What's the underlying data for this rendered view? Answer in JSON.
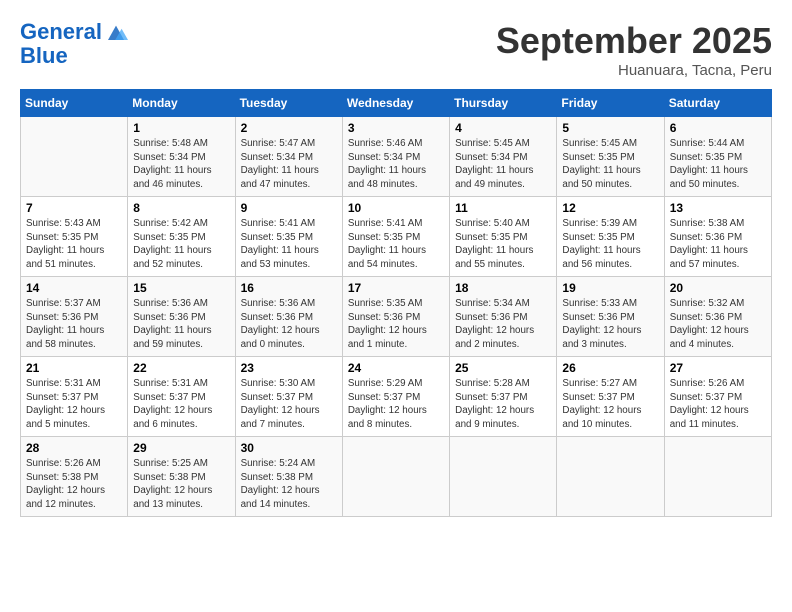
{
  "header": {
    "logo_line1": "General",
    "logo_line2": "Blue",
    "month_title": "September 2025",
    "location": "Huanuara, Tacna, Peru"
  },
  "days_of_week": [
    "Sunday",
    "Monday",
    "Tuesday",
    "Wednesday",
    "Thursday",
    "Friday",
    "Saturday"
  ],
  "weeks": [
    [
      {
        "day": "",
        "sunrise": "",
        "sunset": "",
        "daylight": ""
      },
      {
        "day": "1",
        "sunrise": "Sunrise: 5:48 AM",
        "sunset": "Sunset: 5:34 PM",
        "daylight": "Daylight: 11 hours and 46 minutes."
      },
      {
        "day": "2",
        "sunrise": "Sunrise: 5:47 AM",
        "sunset": "Sunset: 5:34 PM",
        "daylight": "Daylight: 11 hours and 47 minutes."
      },
      {
        "day": "3",
        "sunrise": "Sunrise: 5:46 AM",
        "sunset": "Sunset: 5:34 PM",
        "daylight": "Daylight: 11 hours and 48 minutes."
      },
      {
        "day": "4",
        "sunrise": "Sunrise: 5:45 AM",
        "sunset": "Sunset: 5:34 PM",
        "daylight": "Daylight: 11 hours and 49 minutes."
      },
      {
        "day": "5",
        "sunrise": "Sunrise: 5:45 AM",
        "sunset": "Sunset: 5:35 PM",
        "daylight": "Daylight: 11 hours and 50 minutes."
      },
      {
        "day": "6",
        "sunrise": "Sunrise: 5:44 AM",
        "sunset": "Sunset: 5:35 PM",
        "daylight": "Daylight: 11 hours and 50 minutes."
      }
    ],
    [
      {
        "day": "7",
        "sunrise": "Sunrise: 5:43 AM",
        "sunset": "Sunset: 5:35 PM",
        "daylight": "Daylight: 11 hours and 51 minutes."
      },
      {
        "day": "8",
        "sunrise": "Sunrise: 5:42 AM",
        "sunset": "Sunset: 5:35 PM",
        "daylight": "Daylight: 11 hours and 52 minutes."
      },
      {
        "day": "9",
        "sunrise": "Sunrise: 5:41 AM",
        "sunset": "Sunset: 5:35 PM",
        "daylight": "Daylight: 11 hours and 53 minutes."
      },
      {
        "day": "10",
        "sunrise": "Sunrise: 5:41 AM",
        "sunset": "Sunset: 5:35 PM",
        "daylight": "Daylight: 11 hours and 54 minutes."
      },
      {
        "day": "11",
        "sunrise": "Sunrise: 5:40 AM",
        "sunset": "Sunset: 5:35 PM",
        "daylight": "Daylight: 11 hours and 55 minutes."
      },
      {
        "day": "12",
        "sunrise": "Sunrise: 5:39 AM",
        "sunset": "Sunset: 5:35 PM",
        "daylight": "Daylight: 11 hours and 56 minutes."
      },
      {
        "day": "13",
        "sunrise": "Sunrise: 5:38 AM",
        "sunset": "Sunset: 5:36 PM",
        "daylight": "Daylight: 11 hours and 57 minutes."
      }
    ],
    [
      {
        "day": "14",
        "sunrise": "Sunrise: 5:37 AM",
        "sunset": "Sunset: 5:36 PM",
        "daylight": "Daylight: 11 hours and 58 minutes."
      },
      {
        "day": "15",
        "sunrise": "Sunrise: 5:36 AM",
        "sunset": "Sunset: 5:36 PM",
        "daylight": "Daylight: 11 hours and 59 minutes."
      },
      {
        "day": "16",
        "sunrise": "Sunrise: 5:36 AM",
        "sunset": "Sunset: 5:36 PM",
        "daylight": "Daylight: 12 hours and 0 minutes."
      },
      {
        "day": "17",
        "sunrise": "Sunrise: 5:35 AM",
        "sunset": "Sunset: 5:36 PM",
        "daylight": "Daylight: 12 hours and 1 minute."
      },
      {
        "day": "18",
        "sunrise": "Sunrise: 5:34 AM",
        "sunset": "Sunset: 5:36 PM",
        "daylight": "Daylight: 12 hours and 2 minutes."
      },
      {
        "day": "19",
        "sunrise": "Sunrise: 5:33 AM",
        "sunset": "Sunset: 5:36 PM",
        "daylight": "Daylight: 12 hours and 3 minutes."
      },
      {
        "day": "20",
        "sunrise": "Sunrise: 5:32 AM",
        "sunset": "Sunset: 5:36 PM",
        "daylight": "Daylight: 12 hours and 4 minutes."
      }
    ],
    [
      {
        "day": "21",
        "sunrise": "Sunrise: 5:31 AM",
        "sunset": "Sunset: 5:37 PM",
        "daylight": "Daylight: 12 hours and 5 minutes."
      },
      {
        "day": "22",
        "sunrise": "Sunrise: 5:31 AM",
        "sunset": "Sunset: 5:37 PM",
        "daylight": "Daylight: 12 hours and 6 minutes."
      },
      {
        "day": "23",
        "sunrise": "Sunrise: 5:30 AM",
        "sunset": "Sunset: 5:37 PM",
        "daylight": "Daylight: 12 hours and 7 minutes."
      },
      {
        "day": "24",
        "sunrise": "Sunrise: 5:29 AM",
        "sunset": "Sunset: 5:37 PM",
        "daylight": "Daylight: 12 hours and 8 minutes."
      },
      {
        "day": "25",
        "sunrise": "Sunrise: 5:28 AM",
        "sunset": "Sunset: 5:37 PM",
        "daylight": "Daylight: 12 hours and 9 minutes."
      },
      {
        "day": "26",
        "sunrise": "Sunrise: 5:27 AM",
        "sunset": "Sunset: 5:37 PM",
        "daylight": "Daylight: 12 hours and 10 minutes."
      },
      {
        "day": "27",
        "sunrise": "Sunrise: 5:26 AM",
        "sunset": "Sunset: 5:37 PM",
        "daylight": "Daylight: 12 hours and 11 minutes."
      }
    ],
    [
      {
        "day": "28",
        "sunrise": "Sunrise: 5:26 AM",
        "sunset": "Sunset: 5:38 PM",
        "daylight": "Daylight: 12 hours and 12 minutes."
      },
      {
        "day": "29",
        "sunrise": "Sunrise: 5:25 AM",
        "sunset": "Sunset: 5:38 PM",
        "daylight": "Daylight: 12 hours and 13 minutes."
      },
      {
        "day": "30",
        "sunrise": "Sunrise: 5:24 AM",
        "sunset": "Sunset: 5:38 PM",
        "daylight": "Daylight: 12 hours and 14 minutes."
      },
      {
        "day": "",
        "sunrise": "",
        "sunset": "",
        "daylight": ""
      },
      {
        "day": "",
        "sunrise": "",
        "sunset": "",
        "daylight": ""
      },
      {
        "day": "",
        "sunrise": "",
        "sunset": "",
        "daylight": ""
      },
      {
        "day": "",
        "sunrise": "",
        "sunset": "",
        "daylight": ""
      }
    ]
  ]
}
